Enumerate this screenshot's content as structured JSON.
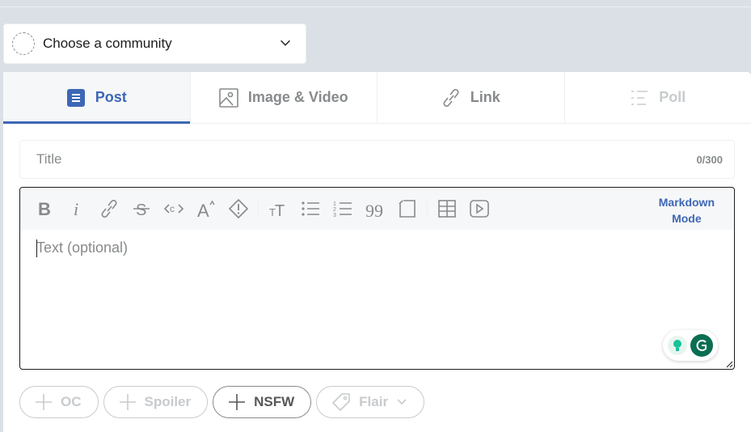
{
  "community": {
    "placeholder": "Choose a community",
    "icon": "chevron-down-icon"
  },
  "tabs": [
    {
      "label": "Post",
      "icon": "post-icon",
      "active": true
    },
    {
      "label": "Image & Video",
      "icon": "image-icon"
    },
    {
      "label": "Link",
      "icon": "link-icon"
    },
    {
      "label": "Poll",
      "icon": "poll-icon",
      "disabled": true
    }
  ],
  "title_field": {
    "placeholder": "Title",
    "counter": "0/300"
  },
  "editor": {
    "toolbar": [
      "bold-icon",
      "italic-icon",
      "link-icon",
      "strikethrough-icon",
      "inline-code-icon",
      "superscript-icon",
      "spoiler-icon",
      "heading-icon",
      "bulleted-list-icon",
      "numbered-list-icon",
      "quote-block-icon",
      "code-block-icon",
      "table-icon",
      "video-icon"
    ],
    "markdown_line1": "Markdown",
    "markdown_line2": "Mode",
    "placeholder": "Text (optional)"
  },
  "flairs": {
    "oc": "OC",
    "spoiler": "Spoiler",
    "nsfw": "NSFW",
    "flair": "Flair"
  },
  "colors": {
    "accent": "#3d67b6",
    "muted": "#878a8c",
    "background": "#dae0e6"
  }
}
